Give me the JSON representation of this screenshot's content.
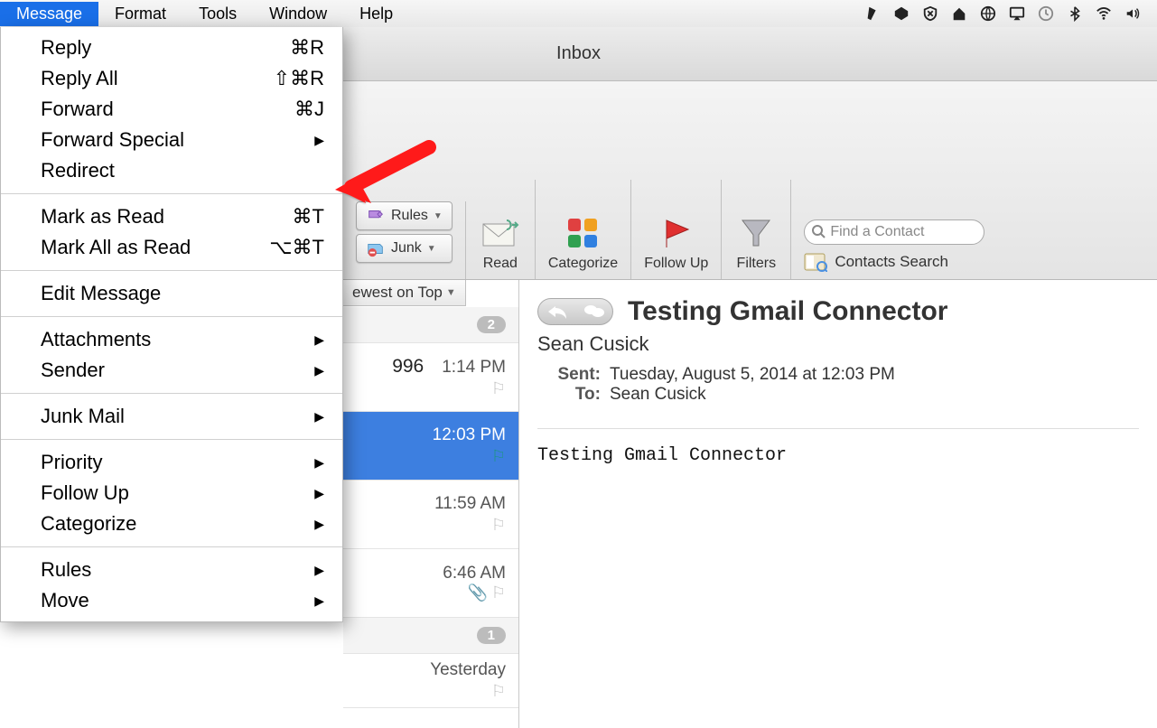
{
  "menubar": {
    "items": [
      "Message",
      "Format",
      "Tools",
      "Window",
      "Help"
    ],
    "active": "Message"
  },
  "dropdown": {
    "groups": [
      [
        {
          "label": "Reply",
          "shortcut": "⌘R"
        },
        {
          "label": "Reply All",
          "shortcut": "⇧⌘R"
        },
        {
          "label": "Forward",
          "shortcut": "⌘J"
        },
        {
          "label": "Forward Special",
          "submenu": true
        },
        {
          "label": "Redirect"
        }
      ],
      [
        {
          "label": "Mark as Read",
          "shortcut": "⌘T"
        },
        {
          "label": "Mark All as Read",
          "shortcut": "⌥⌘T"
        }
      ],
      [
        {
          "label": "Edit Message"
        }
      ],
      [
        {
          "label": "Attachments",
          "submenu": true
        },
        {
          "label": "Sender",
          "submenu": true
        }
      ],
      [
        {
          "label": "Junk Mail",
          "submenu": true
        }
      ],
      [
        {
          "label": "Priority",
          "submenu": true
        },
        {
          "label": "Follow Up",
          "submenu": true
        },
        {
          "label": "Categorize",
          "submenu": true
        }
      ],
      [
        {
          "label": "Rules",
          "submenu": true
        },
        {
          "label": "Move",
          "submenu": true
        }
      ]
    ]
  },
  "window": {
    "title": "Inbox"
  },
  "toolbar": {
    "rules_label": "Rules",
    "junk_label": "Junk",
    "read_label": "Read",
    "categorize_label": "Categorize",
    "followup_label": "Follow Up",
    "filters_label": "Filters",
    "search_placeholder": "Find a Contact",
    "contacts_search_label": "Contacts Search"
  },
  "sort": {
    "label": "ewest on Top"
  },
  "list": {
    "badge_top": "2",
    "rows": [
      {
        "time": "1:14 PM",
        "extra": "996",
        "flag": true,
        "selected": false
      },
      {
        "time": "12:03 PM",
        "flag": true,
        "selected": true
      },
      {
        "time": "11:59 AM",
        "flag": true,
        "selected": false
      },
      {
        "time": "6:46 AM",
        "flag": true,
        "clip": true,
        "selected": false
      }
    ],
    "badge_mid": "1",
    "rows2": [
      {
        "time": "Yesterday",
        "flag": true
      }
    ]
  },
  "reader": {
    "subject": "Testing Gmail Connector",
    "from": "Sean Cusick",
    "sent_label": "Sent:",
    "sent_value": "Tuesday, August 5, 2014 at 12:03 PM",
    "to_label": "To:",
    "to_value": "Sean Cusick",
    "body": "Testing Gmail Connector"
  }
}
